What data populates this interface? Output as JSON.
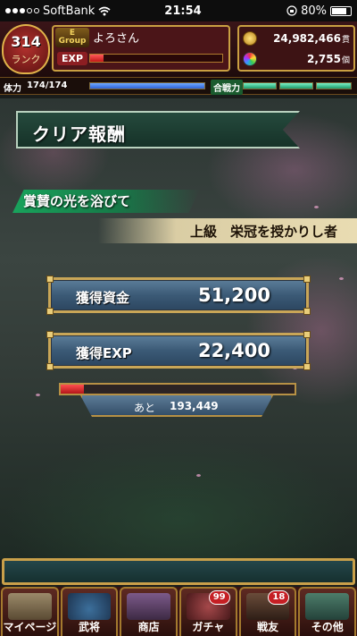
{
  "status_bar": {
    "carrier": "SoftBank",
    "time": "21:54",
    "battery": "80%",
    "battery_level": 0.8,
    "signal_bars_filled": 3,
    "signal_bars_total": 5
  },
  "header": {
    "rank_number": "314",
    "rank_label": "ランク",
    "group_letter": "E",
    "group_text": "Group",
    "username": "よろさん",
    "exp_label": "EXP",
    "exp_fill": 0.1,
    "gold_amount": "24,982,466",
    "gold_unit": "貫",
    "gem_amount": "2,755",
    "gem_unit": "個"
  },
  "stamina": {
    "label": "体力",
    "value": "174/174",
    "fill": 1.0,
    "power_label": "合戦力",
    "power_segments_filled": 3
  },
  "result": {
    "title": "クリア報酬",
    "subtitle": "賞賛の光を浴びて",
    "achievement": "上級　栄冠を授かりし者",
    "funds_label": "獲得資金",
    "funds_value": "51,200",
    "exp_label": "獲得EXP",
    "exp_value": "22,400",
    "next_prefix": "あと",
    "next_value": "193,449",
    "next_fill": 0.1
  },
  "tabs": [
    {
      "label": "マイページ",
      "badge": ""
    },
    {
      "label": "武将",
      "badge": ""
    },
    {
      "label": "商店",
      "badge": ""
    },
    {
      "label": "ガチャ",
      "badge": "99"
    },
    {
      "label": "戦友",
      "badge": "18"
    },
    {
      "label": "その他",
      "badge": ""
    }
  ],
  "colors": {
    "accent_gold": "#c9a657",
    "panel_blue": "#3b5a76",
    "banner_green": "#254a3d",
    "ribbon_green": "#19a35c",
    "bar_red": "#c21818",
    "badge_red": "#c51f24"
  },
  "icons": {
    "gold": "coin-icon",
    "gem": "gem-icon",
    "wifi": "wifi-icon",
    "lock": "rotation-lock-icon"
  }
}
